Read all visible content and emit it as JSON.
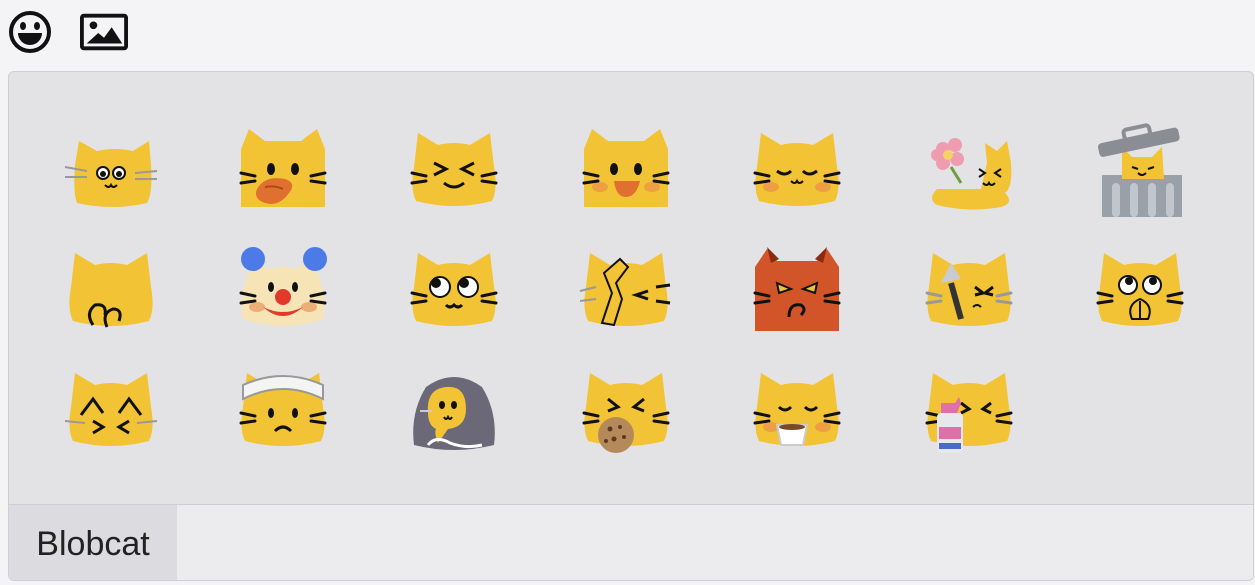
{
  "toolbar": {
    "items": [
      {
        "name": "emoji-picker-button",
        "icon": "smiley-face-icon"
      },
      {
        "name": "image-upload-button",
        "icon": "image-icon"
      }
    ]
  },
  "picker": {
    "category_tab": "Blobcat",
    "emoji": [
      {
        "id": "blobcat-peek-whiskers",
        "variant": "peek"
      },
      {
        "id": "blobcat-tongue-blush",
        "variant": "tongue"
      },
      {
        "id": "blobcat-happy-squint",
        "variant": "squint"
      },
      {
        "id": "blobcat-grin-blush",
        "variant": "grin"
      },
      {
        "id": "blobcat-content",
        "variant": "content"
      },
      {
        "id": "blobcat-flower",
        "variant": "flower"
      },
      {
        "id": "blobcat-trash-can",
        "variant": "trash"
      },
      {
        "id": "blobcat-back",
        "variant": "back"
      },
      {
        "id": "blobcat-clown",
        "variant": "clown"
      },
      {
        "id": "blobcat-googly-eyes",
        "variant": "googly"
      },
      {
        "id": "blobcat-facepalm",
        "variant": "facepalm"
      },
      {
        "id": "blobcat-devil",
        "variant": "devil"
      },
      {
        "id": "blobcat-knife",
        "variant": "knife"
      },
      {
        "id": "blobcat-pleading-pray",
        "variant": "pray"
      },
      {
        "id": "blobcat-cover-eyes",
        "variant": "cover"
      },
      {
        "id": "blobcat-bandage",
        "variant": "bandage"
      },
      {
        "id": "blobcat-hooded",
        "variant": "hooded"
      },
      {
        "id": "blobcat-cookie",
        "variant": "cookie"
      },
      {
        "id": "blobcat-coffee",
        "variant": "coffee"
      },
      {
        "id": "blobcat-spray-cleaner",
        "variant": "spray"
      }
    ]
  },
  "colors": {
    "cat_yellow": "#f2c335",
    "cat_shade": "#e0ad20",
    "panel_bg": "#e3e3e6",
    "tab_bg": "#dcdce0"
  }
}
